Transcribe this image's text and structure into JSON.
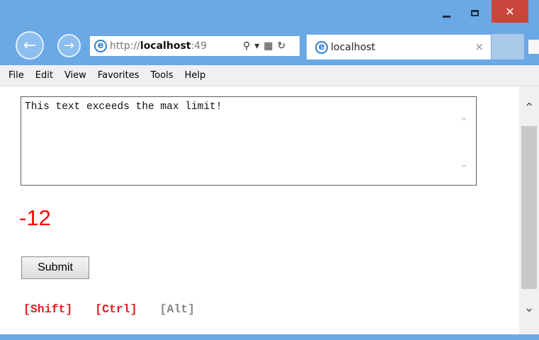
{
  "browser": {
    "address": {
      "host": "localhost",
      "prefix": "http://",
      "rest": ":49",
      "search_icon": "search-icon",
      "refresh_icon": "refresh-icon"
    },
    "tab": {
      "title": "localhost",
      "close": "×"
    },
    "window_buttons": {
      "close": "✕"
    }
  },
  "menu": {
    "items": [
      "File",
      "Edit",
      "View",
      "Favorites",
      "Tools",
      "Help"
    ]
  },
  "page": {
    "textarea_value": "This text exceeds the max limit!",
    "counter": "-12",
    "submit_label": "Submit",
    "keys": [
      {
        "label": "[Shift]",
        "active": true
      },
      {
        "label": "[Ctrl]",
        "active": true
      },
      {
        "label": "[Alt]",
        "active": false
      }
    ]
  },
  "colors": {
    "frame": "#6aa8e6",
    "counter": "#ff0000",
    "key_active": "#e0201f",
    "key_inactive": "#888888"
  }
}
